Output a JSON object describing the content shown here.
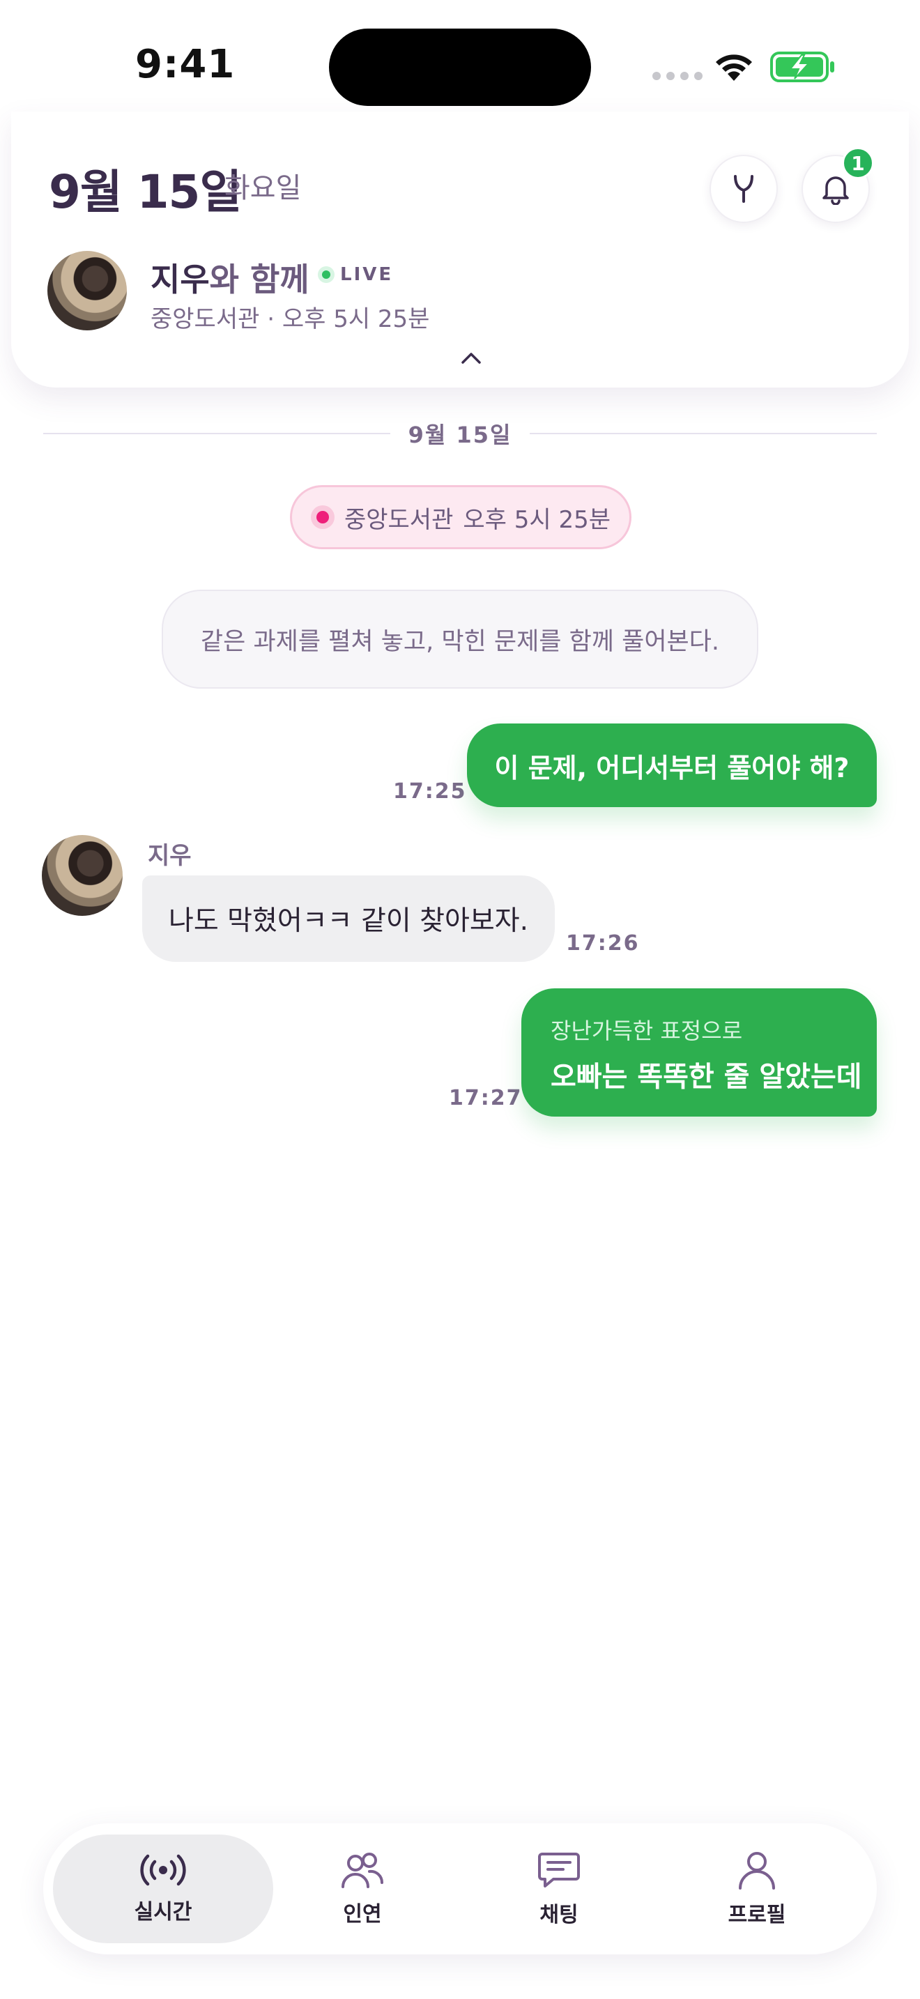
{
  "status_bar": {
    "time": "9:41"
  },
  "header": {
    "date": "9월 15일",
    "day": "화요일",
    "notification_count": "1",
    "companion_name": "지우",
    "companion_suffix": "와 함께",
    "live_label": "LIVE",
    "session_detail": "중앙도서관 · 오후 5시 25분"
  },
  "chat": {
    "date_divider": "9월 15일",
    "location_pill": {
      "place": "중앙도서관",
      "time": "오후 5시 25분"
    },
    "system_note": "같은 과제를 펼쳐 놓고, 막힌 문제를 함께 풀어본다.",
    "messages": [
      {
        "direction": "out",
        "text": "이 문제, 어디서부터 풀어야 해?",
        "time": "17:25"
      },
      {
        "direction": "in",
        "sender": "지우",
        "text": "나도 막혔어ㅋㅋ 같이 찾아보자.",
        "time": "17:26"
      },
      {
        "direction": "out",
        "hint": "장난가득한 표정으로",
        "text": "오빠는 똑똑한 줄 알았는데",
        "time": "17:27"
      }
    ]
  },
  "tab_bar": {
    "tabs": [
      {
        "label": "실시간",
        "icon": "live-broadcast-icon",
        "active": true
      },
      {
        "label": "인연",
        "icon": "people-icon",
        "active": false
      },
      {
        "label": "채팅",
        "icon": "chat-bubble-icon",
        "active": false
      },
      {
        "label": "프로필",
        "icon": "person-icon",
        "active": false
      }
    ]
  },
  "colors": {
    "accent_green": "#2daf4f",
    "live_green": "#2fbf62",
    "pin_pink": "#ee1f7a",
    "text_primary": "#3a2c4c"
  }
}
